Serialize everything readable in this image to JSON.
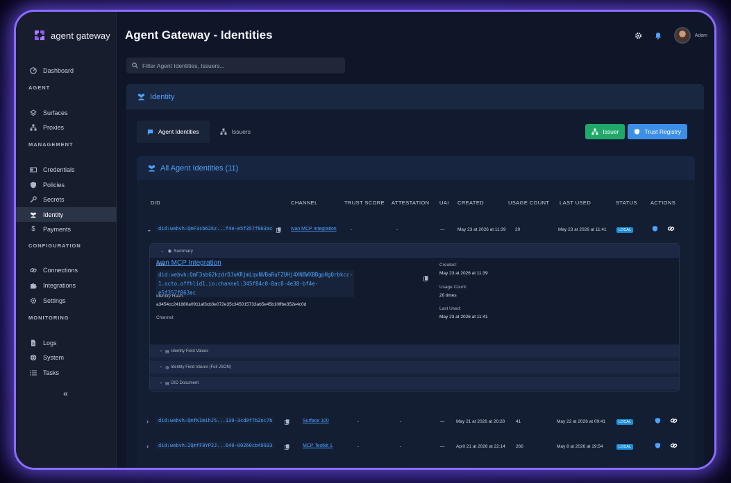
{
  "brand": {
    "name": "agent gateway"
  },
  "sidebar": {
    "top": [
      {
        "label": "Dashboard"
      }
    ],
    "sections": [
      {
        "title": "AGENT",
        "items": [
          {
            "label": "Surfaces"
          },
          {
            "label": "Proxies"
          }
        ]
      },
      {
        "title": "MANAGEMENT",
        "items": [
          {
            "label": "Credentials"
          },
          {
            "label": "Policies"
          },
          {
            "label": "Secrets"
          },
          {
            "label": "Identity"
          },
          {
            "label": "Payments"
          }
        ]
      },
      {
        "title": "CONFIGURATION",
        "items": [
          {
            "label": "Connections"
          },
          {
            "label": "Integrations"
          },
          {
            "label": "Settings"
          }
        ]
      },
      {
        "title": "MONITORING",
        "items": [
          {
            "label": "Logs"
          },
          {
            "label": "System"
          },
          {
            "label": "Tasks"
          }
        ]
      }
    ],
    "collapse_label": "«"
  },
  "header": {
    "title": "Agent Gateway - Identities",
    "user": "Adam"
  },
  "search": {
    "placeholder": "Filter Agent Identities, Issuers..."
  },
  "card": {
    "title": "Identity"
  },
  "tabs": [
    {
      "label": "Agent Identities"
    },
    {
      "label": "Issuers"
    }
  ],
  "buttons": {
    "issuer": "Issuer",
    "trust_registry": "Trust Registry"
  },
  "list": {
    "title": "All Agent Identities (11)"
  },
  "columns": [
    "DID",
    "CHANNEL",
    "TRUST SCORE",
    "ATTESTATION",
    "UAI",
    "CREATED",
    "USAGE COUNT",
    "LAST USED",
    "STATUS",
    "ACTIONS"
  ],
  "rows": [
    {
      "did": "did:webvh:QmF3sb62kz...f4e-e5f357f863ac",
      "channel": "Ivan MCP Integration",
      "trust": "-",
      "attestation": "-",
      "uai": "—",
      "created": "May 23 at 2026 at 11:39",
      "usage": "20",
      "last_used": "May 23 at 2026 at 11:41",
      "status": "LOCAL"
    },
    {
      "did": "did:webvh:QmfKImihJ5...139-3cd9f7b2oc7b",
      "channel": "Surface 100",
      "trust": "-",
      "attestation": "-",
      "uai": "—",
      "created": "May 21 at 2026 at 20:28",
      "usage": "41",
      "last_used": "May 22 at 2026 at 09:41",
      "status": "LOCAL"
    },
    {
      "did": "did:webvh:2QmfF8YP2J...640-00260cb49933",
      "channel": "MCP Testkit 1",
      "trust": "-",
      "attestation": "-",
      "uai": "—",
      "created": "April 21 at 2026 at 22:14",
      "usage": "266",
      "last_used": "May 8 at 2026 at 19:54",
      "status": "LOCAL"
    }
  ],
  "detail": {
    "summary_label": "Summary",
    "did_label": "DID:",
    "did_full_line1": "did:webvh:QmF3sb62kzdrDJoKRjmLqvNVBaRuFZUHj4XN8WXBBgpHgQrbkcc-",
    "did_full_line2": "1.octo.offhlid1.io:channel:345f84c0-8ac8-4e38-bf4e-e5f357f863ac",
    "hash_label": "Identity Hash:",
    "hash_value": "a3454cc241880a0911af3cb3e072e35c345015733ab5e45b10ffbe352e4c0d",
    "channel_label": "Channel:",
    "channel_value": "Ivan MCP Integration",
    "created_label": "Created:",
    "created_value": "May 23 at 2026 at 11:39",
    "usage_label": "Usage Count:",
    "usage_value": "20 times",
    "last_used_label": "Last Used:",
    "last_used_value": "May 23 at 2026 at 11:41",
    "sections": [
      "Identity Field Values",
      "Identity Field Values (Full JSON)",
      "DID Document"
    ]
  },
  "colors": {
    "accent": "#4da3ff",
    "green": "#1fa86a",
    "blue": "#3c8fe6",
    "frame": "#8a6cff"
  }
}
